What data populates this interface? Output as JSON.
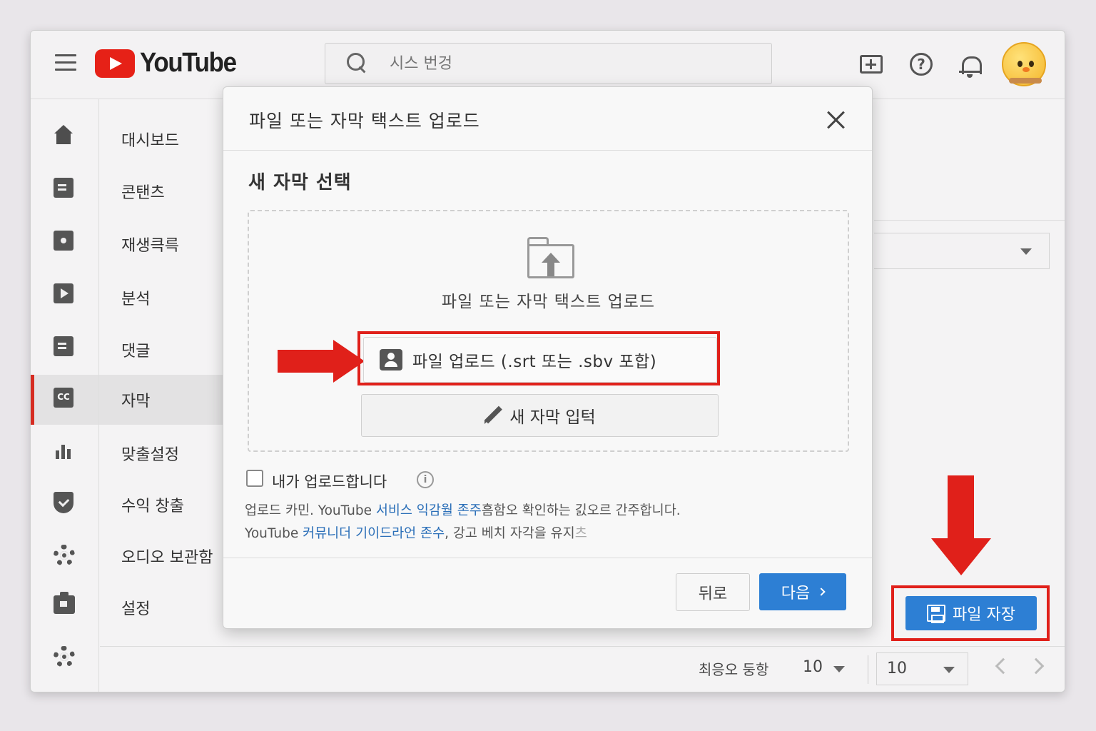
{
  "topbar": {
    "logo_text": "YouTube",
    "search_placeholder": "시스 번겅"
  },
  "sidebar": {
    "items": [
      {
        "label": "대시보드",
        "icon": "home-icon"
      },
      {
        "label": "콘탠츠",
        "icon": "content-icon"
      },
      {
        "label": "재생큭륵",
        "icon": "playlist-icon"
      },
      {
        "label": "분석",
        "icon": "play-icon"
      },
      {
        "label": "댓글",
        "icon": "comments-icon"
      },
      {
        "label": "자막",
        "icon": "cc-icon",
        "active": true
      },
      {
        "label": "맞출설정",
        "icon": "analytics-bars-icon"
      },
      {
        "label": "수익 창출",
        "icon": "shield-icon"
      },
      {
        "label": "오디오 보관함",
        "icon": "gear-icon"
      },
      {
        "label": "설정",
        "icon": "camera-icon"
      }
    ],
    "bottom_icon": "gear-icon",
    "cc_text": "CC"
  },
  "modal": {
    "title": "파일 또는 자막 택스트 업로드",
    "section_title": "새 자막 선택",
    "dropzone_text": "파일 또는 자막 택스트 업로드",
    "upload_button_label": "파일 업로드 (.srt 또는 .sbv 포합)",
    "new_subtitle_button_label": "새 자막 입턱",
    "checkbox_label": "내가 업로드합니다",
    "info_symbol": "i",
    "terms_line1_prefix": "업로드 카민. YouTube ",
    "terms_line1_link": "서비스 익감월 존주",
    "terms_line1_suffix": "흠함오 확인하는 긼오르 간주합니다.",
    "terms_line2_prefix": "YouTube ",
    "terms_line2_link": "커뮤니더 기이드라언 존수",
    "terms_line2_suffix": ", 강고 베치 자각을 유지",
    "terms_line2_fade": "츠",
    "back_label": "뒤로",
    "next_label": "다음"
  },
  "right_panel": {
    "save_button_label": "파일 자장"
  },
  "pagination": {
    "rows_label": "최응오 둥항",
    "rows_value": "10",
    "page_value": "10"
  },
  "colors": {
    "accent_blue": "#2d7fd4",
    "youtube_red": "#e62117",
    "annotation_red": "#e0201a"
  }
}
